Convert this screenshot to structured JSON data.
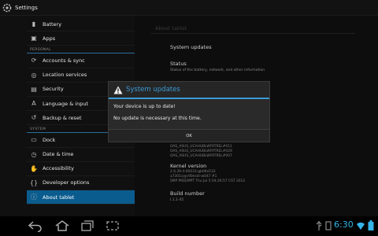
{
  "app": {
    "title": "Settings"
  },
  "sidebar": {
    "items_top": [
      {
        "label": "Battery",
        "icon": "battery-icon"
      },
      {
        "label": "Apps",
        "icon": "apps-icon"
      }
    ],
    "personal_header": "PERSONAL",
    "personal_items": [
      {
        "label": "Accounts & sync",
        "icon": "sync-icon"
      },
      {
        "label": "Location services",
        "icon": "location-icon"
      },
      {
        "label": "Security",
        "icon": "lock-icon"
      },
      {
        "label": "Language & input",
        "icon": "language-icon"
      },
      {
        "label": "Backup & reset",
        "icon": "backup-icon"
      }
    ],
    "system_header": "SYSTEM",
    "system_items": [
      {
        "label": "Dock",
        "icon": "dock-icon"
      },
      {
        "label": "Date & time",
        "icon": "clock-icon"
      },
      {
        "label": "Accessibility",
        "icon": "accessibility-icon"
      },
      {
        "label": "Developer options",
        "icon": "developer-icon"
      },
      {
        "label": "About tablet",
        "icon": "info-icon",
        "selected": true
      }
    ]
  },
  "content": {
    "header": "About tablet",
    "system_updates": "System updates",
    "status_title": "Status",
    "status_sub": "Status of the battery, network, and other information",
    "build_lines": [
      "OAS_ASUS_UCAHUBLWFRTREL#011",
      "OAS_ASUS_UCAHUBLWFRTREL#029",
      "OAS_ASUS_UCAHUBLWFRTREL#007"
    ],
    "kernel_title": "Kernel version",
    "kernel_lines": [
      "2.6.39.4-00033-gb06e533",
      "a7301c@c90esdr-w047 #1",
      "SMP PREEMPT Thu Jul 5 04:26:57 CST 2012"
    ],
    "build_title": "Build number",
    "build_value": "I.1.1-45"
  },
  "dialog": {
    "title": "System updates",
    "line1": "Your device is up to date!",
    "line2": "No update is necessary at this time.",
    "ok": "OK"
  },
  "status_bar": {
    "time": "6:30"
  },
  "colors": {
    "accent": "#3a9ad9",
    "selected": "#0b5c8e"
  }
}
